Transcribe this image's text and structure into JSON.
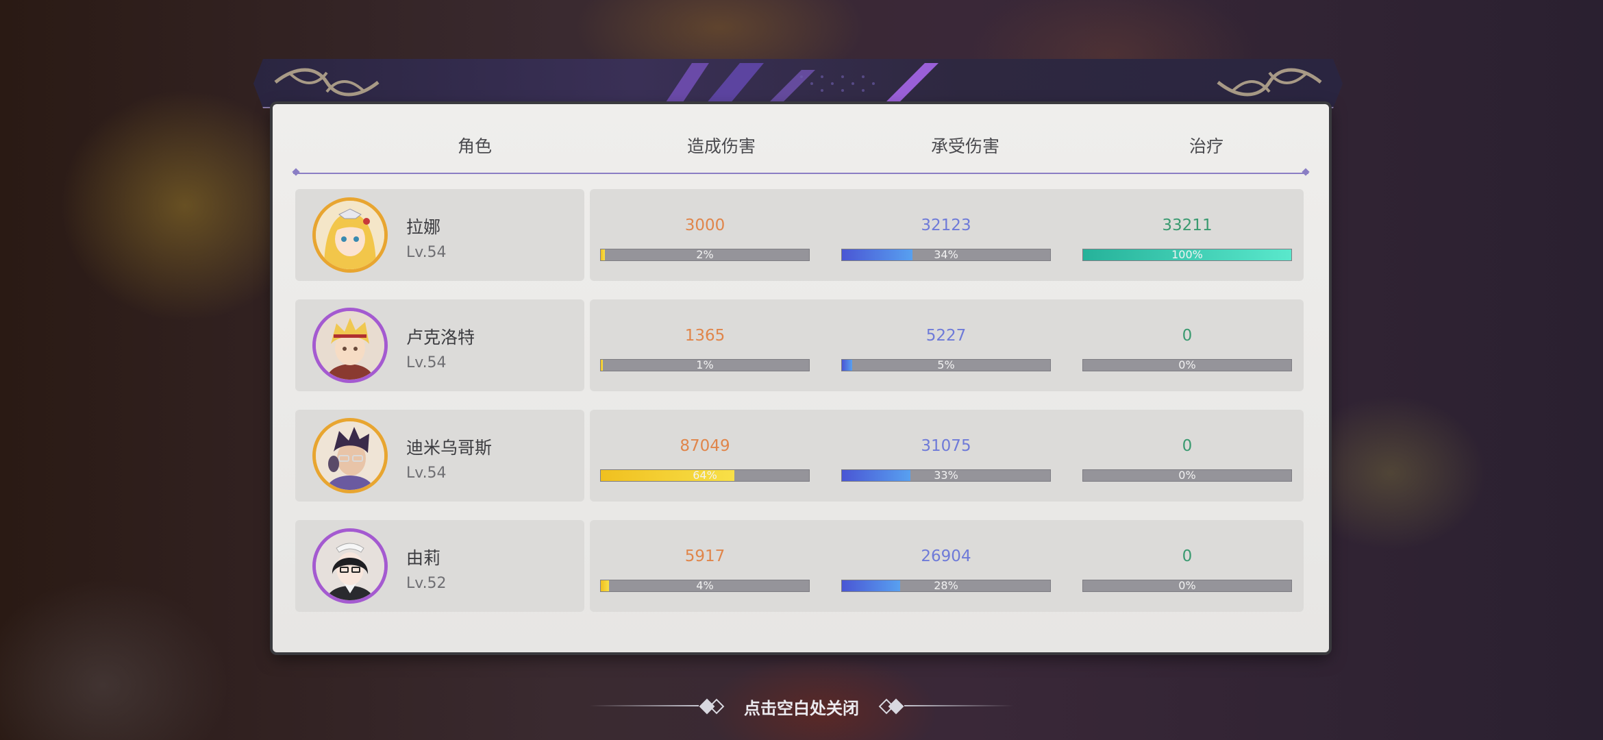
{
  "headers": {
    "character": "角色",
    "damage_dealt": "造成伤害",
    "damage_taken": "承受伤害",
    "healing": "治疗"
  },
  "rows": [
    {
      "name": "拉娜",
      "level": "Lv.54",
      "frame_color": "#e8a530",
      "damage_dealt": {
        "value": "3000",
        "percent": "2%",
        "fill": 0.02
      },
      "damage_taken": {
        "value": "32123",
        "percent": "34%",
        "fill": 0.34
      },
      "healing": {
        "value": "33211",
        "percent": "100%",
        "fill": 1.0
      }
    },
    {
      "name": "卢克洛特",
      "level": "Lv.54",
      "frame_color": "#a45ad0",
      "damage_dealt": {
        "value": "1365",
        "percent": "1%",
        "fill": 0.01
      },
      "damage_taken": {
        "value": "5227",
        "percent": "5%",
        "fill": 0.05
      },
      "healing": {
        "value": "0",
        "percent": "0%",
        "fill": 0
      }
    },
    {
      "name": "迪米乌哥斯",
      "level": "Lv.54",
      "frame_color": "#e8a530",
      "damage_dealt": {
        "value": "87049",
        "percent": "64%",
        "fill": 0.64
      },
      "damage_taken": {
        "value": "31075",
        "percent": "33%",
        "fill": 0.33
      },
      "healing": {
        "value": "0",
        "percent": "0%",
        "fill": 0
      }
    },
    {
      "name": "由莉",
      "level": "Lv.52",
      "frame_color": "#a45ad0",
      "damage_dealt": {
        "value": "5917",
        "percent": "4%",
        "fill": 0.04
      },
      "damage_taken": {
        "value": "26904",
        "percent": "28%",
        "fill": 0.28
      },
      "healing": {
        "value": "0",
        "percent": "0%",
        "fill": 0
      }
    }
  ],
  "close_hint": "点击空白处关闭"
}
